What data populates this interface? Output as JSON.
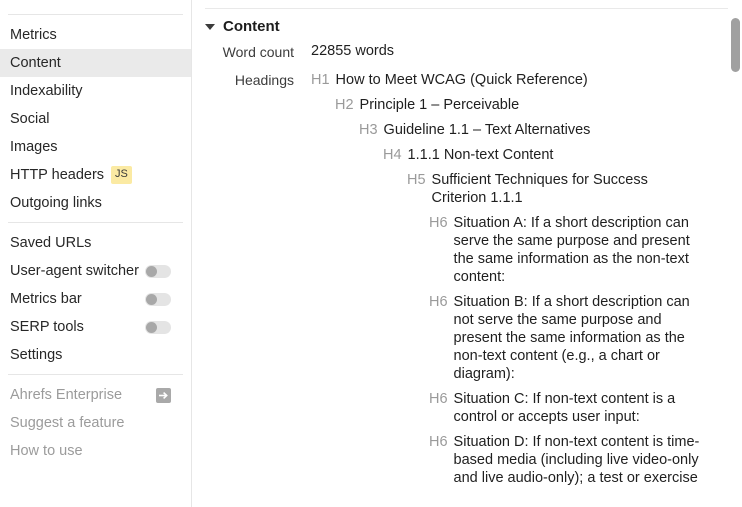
{
  "sidebar": {
    "nav_items": [
      {
        "label": "Metrics",
        "active": false,
        "badge": null
      },
      {
        "label": "Content",
        "active": true,
        "badge": null
      },
      {
        "label": "Indexability",
        "active": false,
        "badge": null
      },
      {
        "label": "Social",
        "active": false,
        "badge": null
      },
      {
        "label": "Images",
        "active": false,
        "badge": null
      },
      {
        "label": "HTTP headers",
        "active": false,
        "badge": "JS"
      },
      {
        "label": "Outgoing links",
        "active": false,
        "badge": null
      }
    ],
    "tool_items": [
      {
        "label": "Saved URLs",
        "toggle": false
      },
      {
        "label": "User-agent switcher",
        "toggle": true
      },
      {
        "label": "Metrics bar",
        "toggle": true
      },
      {
        "label": "SERP tools",
        "toggle": true
      },
      {
        "label": "Settings",
        "toggle": false
      }
    ],
    "footer_items": [
      {
        "label": "Ahrefs Enterprise",
        "icon": "external-link-icon"
      },
      {
        "label": "Suggest a feature",
        "icon": null
      },
      {
        "label": "How to use",
        "icon": null
      }
    ]
  },
  "main": {
    "section_title": "Content",
    "caret_icon": "chevron-down-icon",
    "word_count_label": "Word count",
    "word_count_value": "22855 words",
    "headings_label": "Headings",
    "headings": [
      {
        "tag": "H1",
        "level": 1,
        "text": "How to Meet WCAG (Quick Reference)"
      },
      {
        "tag": "H2",
        "level": 2,
        "text": "Principle 1 – Perceivable"
      },
      {
        "tag": "H3",
        "level": 3,
        "text": "Guideline 1.1 – Text Alternatives"
      },
      {
        "tag": "H4",
        "level": 4,
        "text": "1.1.1 Non-text Content"
      },
      {
        "tag": "H5",
        "level": 5,
        "text": "Sufficient Techniques for Success Criterion 1.1.1"
      },
      {
        "tag": "H6",
        "level": 6,
        "text": "Situation A: If a short description can serve the same purpose and present the same information as the non-text content:"
      },
      {
        "tag": "H6",
        "level": 6,
        "text": "Situation B: If a short description can not serve the same purpose and present the same information as the non-text content (e.g., a chart or diagram):"
      },
      {
        "tag": "H6",
        "level": 6,
        "text": "Situation C: If non-text content is a control or accepts user input:"
      },
      {
        "tag": "H6",
        "level": 6,
        "text": "Situation D: If non-text content is time-based media (including live video-only and live audio-only); a test or exercise"
      }
    ]
  },
  "scrollbar": {
    "name": "vertical-scrollbar"
  },
  "colors": {
    "active_row": "#eaeaea",
    "badge_js_bg": "#fbeaa3",
    "muted_text": "#9b9b9b",
    "tag_text": "#9a9a9a",
    "scrollbar_thumb": "#a0a0a0"
  }
}
